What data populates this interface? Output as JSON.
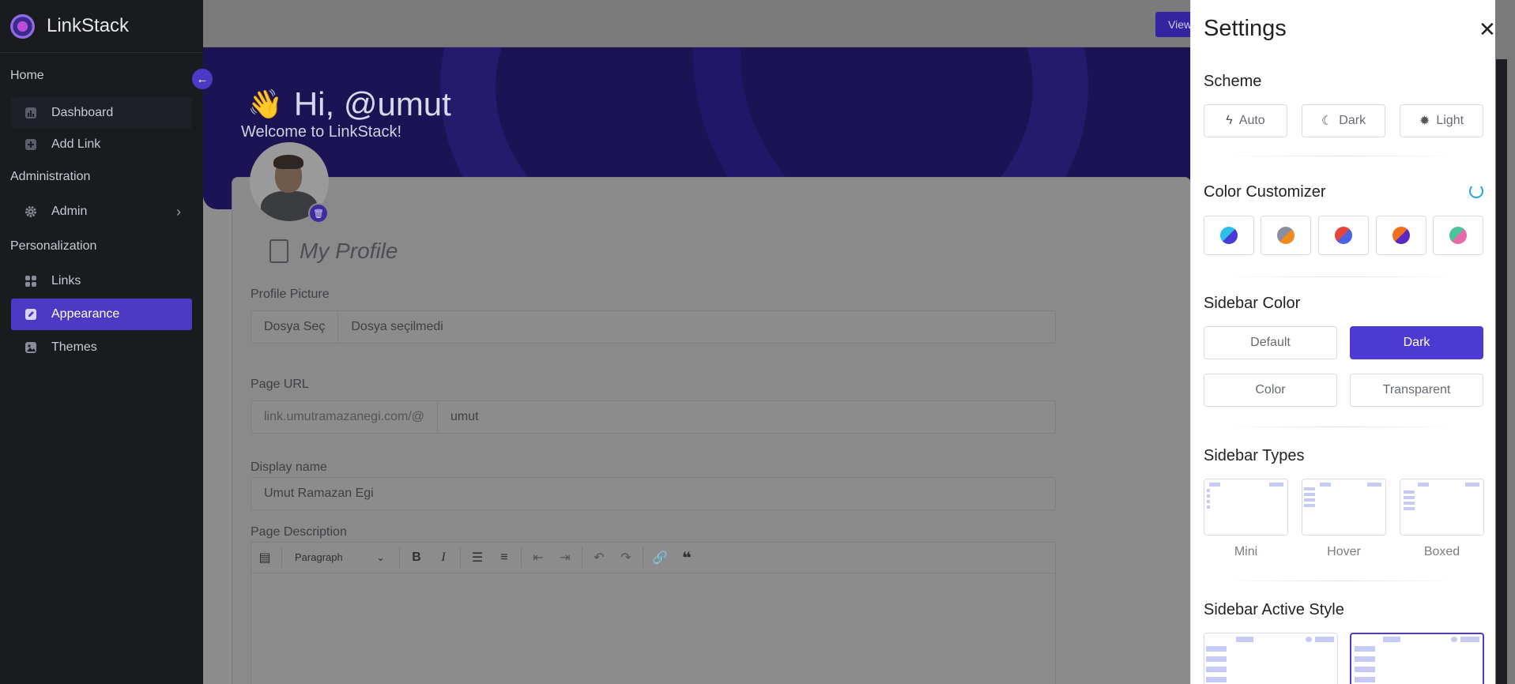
{
  "brand": {
    "name": "LinkStack"
  },
  "sidebar": {
    "sections": [
      {
        "title": "Home"
      },
      {
        "title": "Administration"
      },
      {
        "title": "Personalization"
      }
    ],
    "items": [
      {
        "label": "Dashboard",
        "icon": "chart-icon"
      },
      {
        "label": "Add Link",
        "icon": "plus-square-icon"
      },
      {
        "label": "Admin",
        "icon": "gear-icon"
      },
      {
        "label": "Links",
        "icon": "grid-icon"
      },
      {
        "label": "Appearance",
        "icon": "edit-icon"
      },
      {
        "label": "Themes",
        "icon": "image-icon"
      }
    ],
    "collapse_icon": "arrow-left-icon"
  },
  "topbar": {
    "view_button": "View"
  },
  "hero": {
    "greeting": "Hi, @umut",
    "welcome": "Welcome to LinkStack!",
    "wave_emoji": "👋"
  },
  "profile": {
    "section_title": "My Profile",
    "picture": {
      "label": "Profile Picture",
      "choose": "Dosya Seç",
      "status": "Dosya seçilmedi"
    },
    "page_url": {
      "label": "Page URL",
      "prefix": "link.umutramazanegi.com/@",
      "value": "umut"
    },
    "display_name": {
      "label": "Display name",
      "value": "Umut Ramazan Egi"
    },
    "description": {
      "label": "Page Description",
      "paragraph_select": "Paragraph"
    }
  },
  "settings": {
    "title": "Settings",
    "scheme": {
      "title": "Scheme",
      "options": [
        "Auto",
        "Dark",
        "Light"
      ]
    },
    "color_customizer": {
      "title": "Color Customizer",
      "swatches": [
        [
          "#2dbfe8",
          "#4a3ad8"
        ],
        [
          "#8a8fa0",
          "#f08a1c"
        ],
        [
          "#e8423c",
          "#4a63e0"
        ],
        [
          "#f0701c",
          "#5a2ac0"
        ],
        [
          "#4cc49a",
          "#e86aa8"
        ]
      ]
    },
    "sidebar_color": {
      "title": "Sidebar Color",
      "options": [
        "Default",
        "Dark",
        "Color",
        "Transparent"
      ],
      "selected": "Dark"
    },
    "sidebar_types": {
      "title": "Sidebar Types",
      "options": [
        "Mini",
        "Hover",
        "Boxed"
      ]
    },
    "sidebar_active_style": {
      "title": "Sidebar Active Style"
    }
  },
  "colors": {
    "accent": "#4d3ad4",
    "sidebar_bg": "#1a1b1f"
  }
}
